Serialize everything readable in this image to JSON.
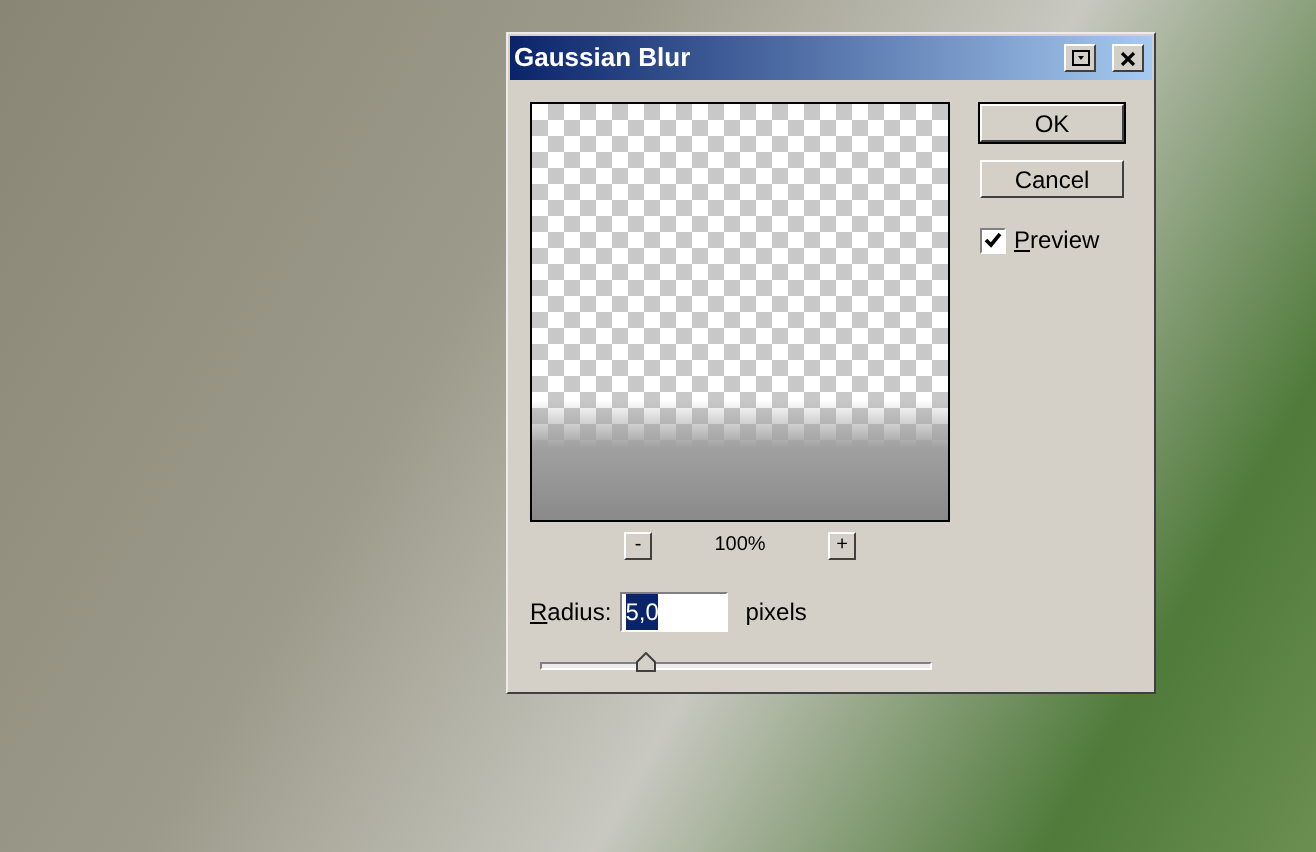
{
  "window": {
    "title": "Gaussian Blur"
  },
  "buttons": [
    {
      "label": "OK",
      "default": true
    },
    {
      "label": "Cancel",
      "default": false
    }
  ],
  "preview_option": {
    "label": "Preview",
    "checked": true
  },
  "zoom": {
    "minus": "-",
    "level": "100%",
    "plus": "+"
  },
  "radius": {
    "label": "Radius:",
    "value": "5,0",
    "value_selected": true,
    "unit": "pixels"
  },
  "radius_slider": {
    "level": 0.27
  }
}
